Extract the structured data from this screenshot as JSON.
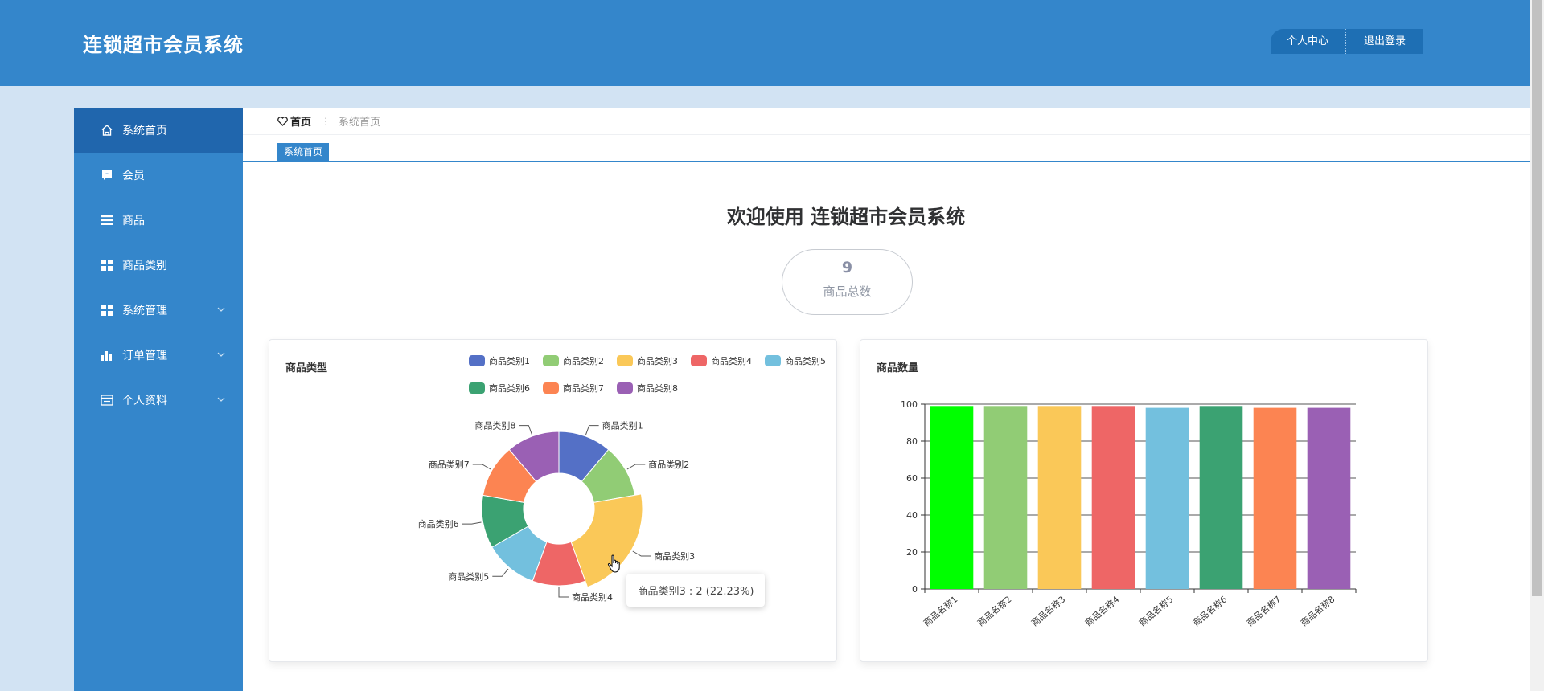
{
  "header": {
    "app_title": "连锁超市会员系统",
    "nav": [
      "个人中心",
      "退出登录"
    ]
  },
  "sidebar": {
    "items": [
      {
        "label": "系统首页",
        "icon": "home-icon",
        "active": true,
        "expandable": false
      },
      {
        "label": "会员",
        "icon": "chat-icon",
        "active": false,
        "expandable": false
      },
      {
        "label": "商品",
        "icon": "list-icon",
        "active": false,
        "expandable": false
      },
      {
        "label": "商品类别",
        "icon": "grid-icon",
        "active": false,
        "expandable": false
      },
      {
        "label": "系统管理",
        "icon": "grid-icon",
        "active": false,
        "expandable": true
      },
      {
        "label": "订单管理",
        "icon": "bar-chart-icon",
        "active": false,
        "expandable": true
      },
      {
        "label": "个人资料",
        "icon": "profile-card-icon",
        "active": false,
        "expandable": true
      }
    ]
  },
  "breadcrumb": {
    "home": "首页",
    "current": "系统首页"
  },
  "tab": {
    "label": "系统首页"
  },
  "welcome": "欢迎使用 连锁超市会员系统",
  "stat": {
    "value": "9",
    "label": "商品总数"
  },
  "tooltip": "商品类别3 : 2 (22.23%)",
  "colors": {
    "primary": "#3486cb",
    "sidebar_active": "#2066ad",
    "header_btn": "#1e6fb4"
  },
  "chart_data": [
    {
      "type": "pie",
      "title": "商品类型",
      "donut": true,
      "legend_position": "top-right",
      "categories": [
        "商品类别1",
        "商品类别2",
        "商品类别3",
        "商品类别4",
        "商品类别5",
        "商品类别6",
        "商品类别7",
        "商品类别8"
      ],
      "values": [
        1,
        1,
        2,
        1,
        1,
        1,
        1,
        1
      ],
      "colors": [
        "#5470c6",
        "#91cc75",
        "#fac858",
        "#ee6666",
        "#73c0de",
        "#3ba272",
        "#fc8452",
        "#9a60b4"
      ],
      "highlighted": "商品类别3"
    },
    {
      "type": "bar",
      "title": "商品数量",
      "categories": [
        "商品名称1",
        "商品名称2",
        "商品名称3",
        "商品名称4",
        "商品名称5",
        "商品名称6",
        "商品名称7",
        "商品名称8"
      ],
      "values": [
        99,
        99,
        99,
        99,
        98,
        99,
        98,
        98
      ],
      "colors": [
        "#00ff00",
        "#91cc75",
        "#fac858",
        "#ee6666",
        "#73c0de",
        "#3ba272",
        "#fc8452",
        "#9a60b4"
      ],
      "ylim": [
        0,
        100
      ],
      "yticks": [
        0,
        20,
        40,
        60,
        80,
        100
      ],
      "grid": true
    }
  ]
}
